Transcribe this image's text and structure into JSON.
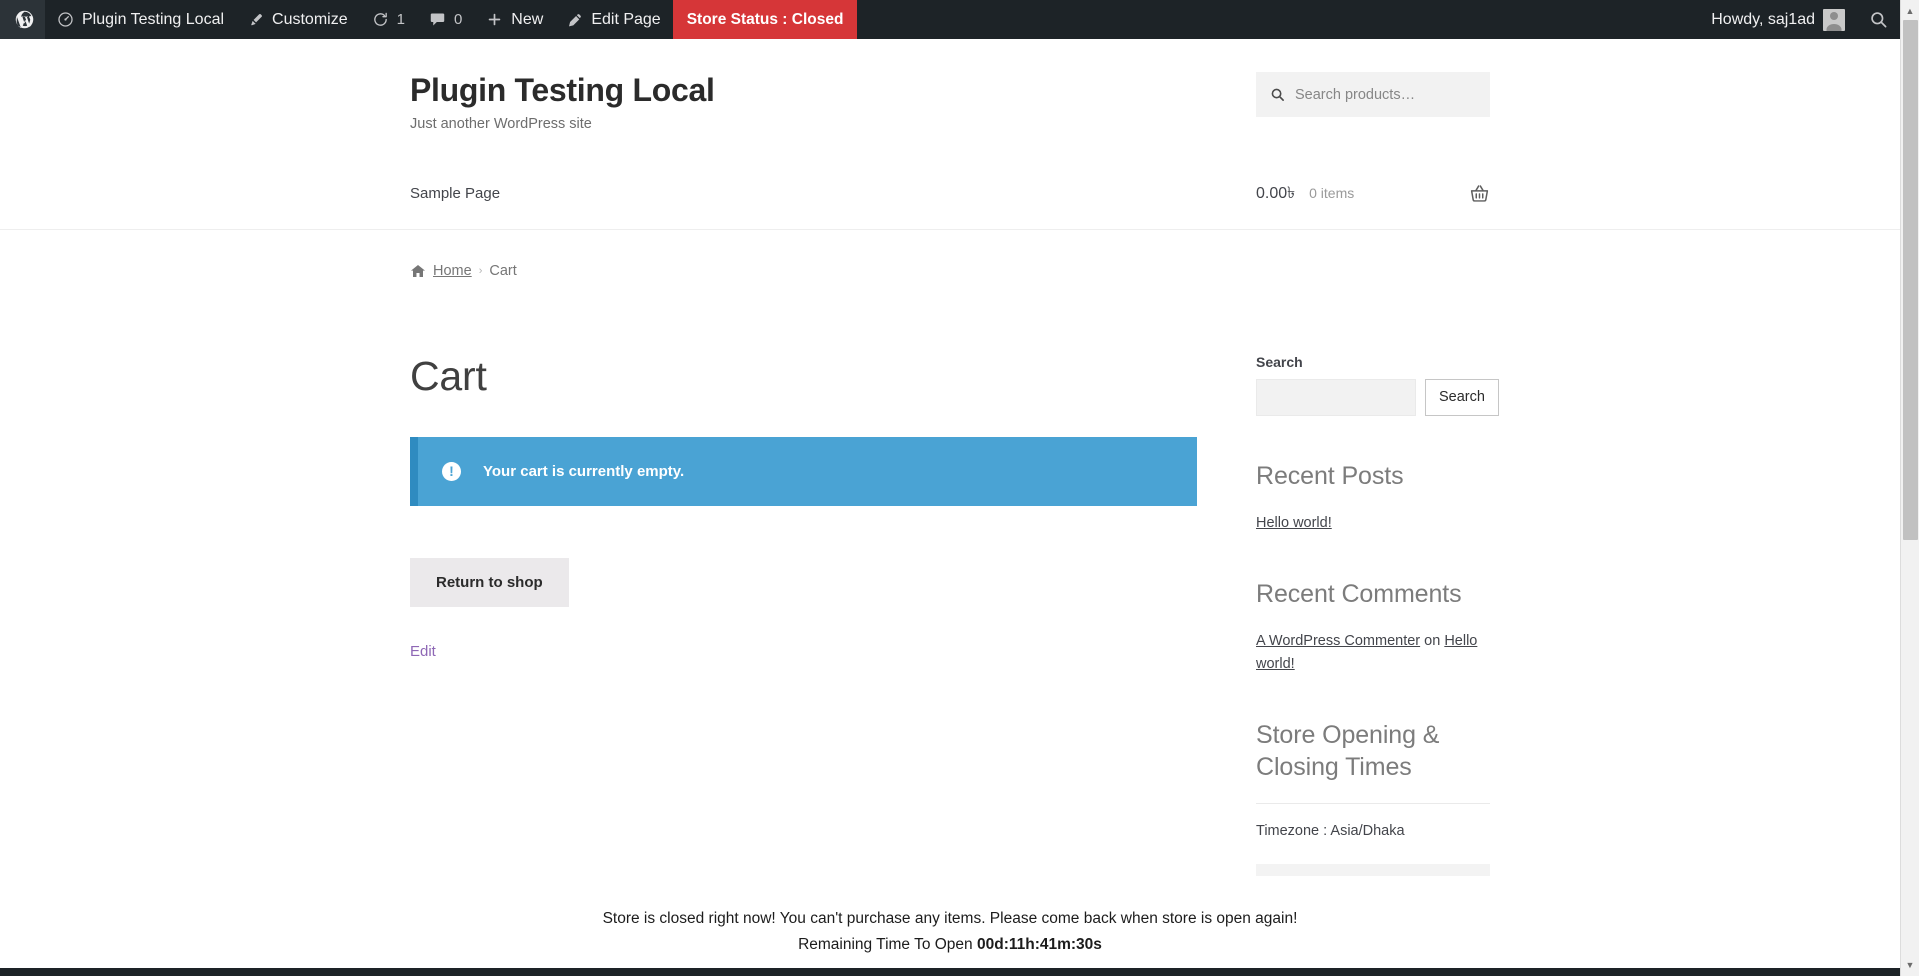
{
  "adminbar": {
    "logo_icon": "wordpress-logo-icon",
    "site_name": "Plugin Testing Local",
    "site_icon": "dashboard-icon",
    "customize_label": "Customize",
    "customize_icon": "paintbrush-icon",
    "updates_icon": "updates-icon",
    "updates_count": "1",
    "comments_icon": "comment-bubble-icon",
    "comments_count": "0",
    "new_label": "New",
    "new_icon": "plus-icon",
    "edit_page_label": "Edit Page",
    "edit_page_icon": "pencil-icon",
    "store_status_label": "Store Status : Closed",
    "store_status_color": "#d63638",
    "howdy_label": "Howdy, saj1ad",
    "avatar_icon": "user-avatar-icon",
    "search_icon": "search-icon"
  },
  "header": {
    "site_title": "Plugin Testing Local",
    "site_description": "Just another WordPress site",
    "product_search": {
      "placeholder": "Search products…",
      "value": "",
      "icon": "search-icon"
    },
    "nav_items": [
      {
        "label": "Sample Page"
      }
    ],
    "cart": {
      "amount": "0.00৳",
      "count": "0 items",
      "icon": "shopping-basket-icon"
    }
  },
  "breadcrumb": {
    "home_icon": "home-icon",
    "home_label": "Home",
    "separator": "›",
    "current": "Cart"
  },
  "main": {
    "page_title": "Cart",
    "notice": {
      "icon": "info-exclamation-icon",
      "icon_glyph": "!",
      "text": "Your cart is currently empty.",
      "background": "#4aa3d4",
      "border_color": "#2f8bc0"
    },
    "return_button": "Return to shop",
    "edit_link": "Edit"
  },
  "sidebar": {
    "search_widget": {
      "title": "Search",
      "input_value": "",
      "button_label": "Search"
    },
    "recent_posts": {
      "title": "Recent Posts",
      "items": [
        {
          "label": "Hello world!"
        }
      ]
    },
    "recent_comments": {
      "title": "Recent Comments",
      "items": [
        {
          "author": "A WordPress Commenter",
          "middle": " on ",
          "post": "Hello world!"
        }
      ]
    },
    "store_times": {
      "title": "Store Opening & Closing Times",
      "timezone": "Timezone : Asia/Dhaka"
    }
  },
  "footer_notice": {
    "message": "Store is closed right now! You can't purchase any items. Please come back when store is open again!",
    "countdown_label": "Remaining Time To Open ",
    "countdown_value": "00d:11h:41m:30s"
  },
  "scrollbar": {
    "up_arrow": "▲",
    "down_arrow": "▼"
  }
}
